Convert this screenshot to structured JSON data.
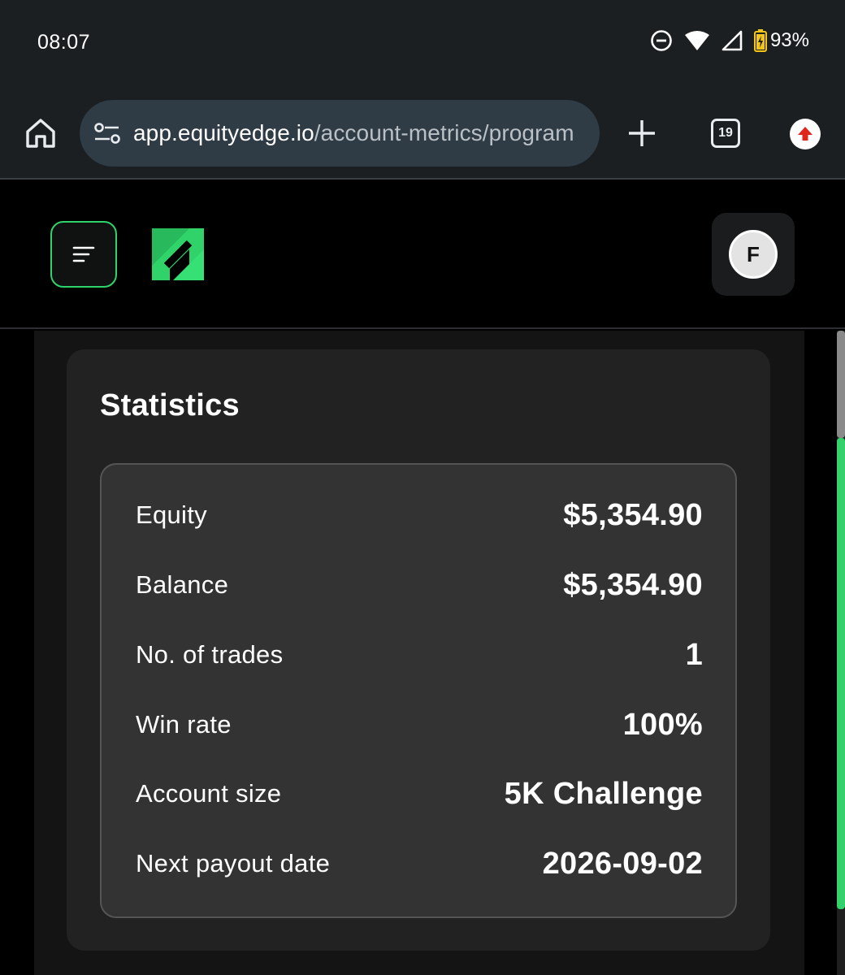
{
  "status_bar": {
    "time": "08:07",
    "battery": "93%",
    "icons": [
      "do-not-disturb-icon",
      "wifi-icon",
      "signal-icon",
      "battery-icon"
    ]
  },
  "browser": {
    "url_host": "app.equityedge.io",
    "url_path": "/account-metrics/program",
    "tab_count": "19",
    "icons": [
      "home-icon",
      "site-settings-icon",
      "new-tab-icon",
      "tabs-icon",
      "update-icon"
    ]
  },
  "app": {
    "avatar_initial": "F",
    "accent_color": "#2fd36a",
    "icons": [
      "menu-icon",
      "brand-logo-icon"
    ]
  },
  "statistics": {
    "title": "Statistics",
    "rows": [
      {
        "label": "Equity",
        "value": "$5,354.90"
      },
      {
        "label": "Balance",
        "value": "$5,354.90"
      },
      {
        "label": "No. of trades",
        "value": "1"
      },
      {
        "label": "Win rate",
        "value": "100%"
      },
      {
        "label": "Account size",
        "value": "5K Challenge"
      },
      {
        "label": "Next payout date",
        "value": "2026-09-02"
      }
    ]
  }
}
